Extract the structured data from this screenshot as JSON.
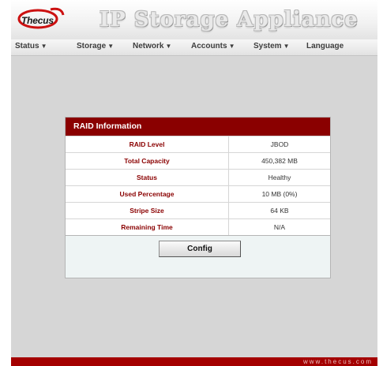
{
  "header": {
    "logo_text": "Thecus",
    "app_title": "IP Storage Appliance"
  },
  "menu": [
    {
      "label": "Status",
      "caret": "▼"
    },
    {
      "label": "Storage",
      "caret": "▼"
    },
    {
      "label": "Network",
      "caret": "▼"
    },
    {
      "label": "Accounts",
      "caret": "▼"
    },
    {
      "label": "System",
      "caret": "▼"
    },
    {
      "label": "Language",
      "caret": ""
    }
  ],
  "raid_panel": {
    "title": "RAID Information",
    "rows": [
      {
        "label": "RAID Level",
        "value": "JBOD"
      },
      {
        "label": "Total Capacity",
        "value": "450,382 MB"
      },
      {
        "label": "Status",
        "value": "Healthy"
      },
      {
        "label": "Used Percentage",
        "value": "10 MB (0%)"
      },
      {
        "label": "Stripe Size",
        "value": "64 KB"
      },
      {
        "label": "Remaining Time",
        "value": "N/A"
      }
    ],
    "config_button": "Config"
  },
  "footer": {
    "url": "www.thecus.com"
  },
  "colors": {
    "brand_red": "#8a0000",
    "background": "#d6d6d6"
  }
}
